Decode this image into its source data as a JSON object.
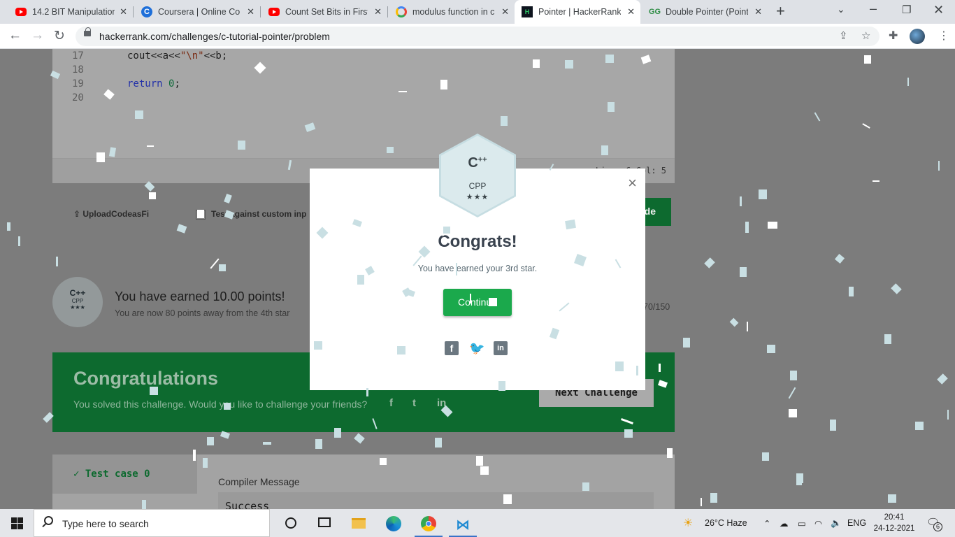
{
  "browser": {
    "tabs": [
      {
        "title": "14.2 BIT Manipulation",
        "favicon": "youtube-icon"
      },
      {
        "title": "Coursera | Online Cou",
        "favicon": "coursera-icon"
      },
      {
        "title": "Count Set Bits in First",
        "favicon": "youtube-icon"
      },
      {
        "title": "modulus function in c",
        "favicon": "google-icon"
      },
      {
        "title": "Pointer | HackerRank",
        "favicon": "hackerrank-icon",
        "active": true
      },
      {
        "title": "Double Pointer (Pointe",
        "favicon": "geeksforgeeks-icon"
      }
    ],
    "url": "hackerrank.com/challenges/c-tutorial-pointer/problem"
  },
  "editor": {
    "lines": [
      {
        "num": "17",
        "code_a": "cout<<a<<",
        "code_str": "\"\\n\"",
        "code_b": "<<b;"
      },
      {
        "num": "18"
      },
      {
        "num": "19",
        "code_kw": "return",
        "code_num": "0",
        "code_end": ";"
      },
      {
        "num": "20"
      }
    ],
    "cursor_info": "Line: 6 Col: 5"
  },
  "submit": {
    "upload_label": "UploadCodeasFi",
    "custom_input_label": "Test against custom inp",
    "submit_fragment": "de"
  },
  "points": {
    "badge_lang": "C++",
    "badge_name": "CPP",
    "badge_stars": "★★★",
    "title": "You have earned 10.00 points!",
    "subtitle": "You are now 80 points away from the 4th star",
    "progress_text": "70/150",
    "progress_fraction": 0.4667
  },
  "congrats_bar": {
    "title": "Congratulations",
    "subtitle": "You solved this challenge. Would you like to challenge your friends?",
    "next_label": "Next Challenge"
  },
  "test_case": {
    "label": "Test case 0",
    "compiler_label": "Compiler Message",
    "compiler_value": "Success"
  },
  "modal": {
    "badge_lang": "C",
    "badge_lang_sup": "++",
    "badge_name": "CPP",
    "badge_stars": "★★★",
    "title": "Congrats!",
    "message": "You have earned your 3rd star.",
    "continue_label": "Continue",
    "close_glyph": "×"
  },
  "taskbar": {
    "search_placeholder": "Type here to search",
    "weather": "26°C  Haze",
    "language": "ENG",
    "time": "20:41",
    "date": "24-12-2021",
    "notifications": "6"
  },
  "colors": {
    "accent_green": "#1ba94c",
    "dark_green": "#0d6a2f",
    "confetti": "#c9dfe3"
  }
}
